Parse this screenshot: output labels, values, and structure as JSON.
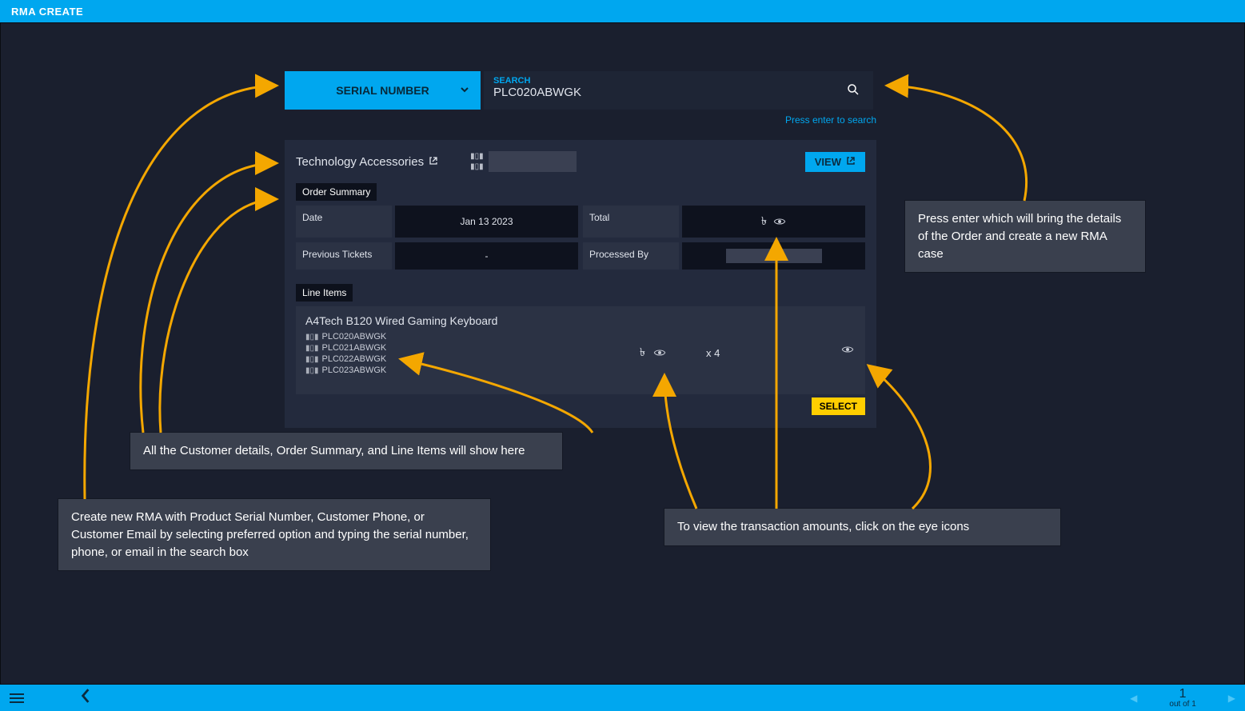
{
  "topbar": {
    "title": "RMA CREATE"
  },
  "search": {
    "dropdown_label": "SERIAL NUMBER",
    "field_label": "SEARCH",
    "value": "PLC020ABWGK",
    "hint": "Press enter to search"
  },
  "panel": {
    "company": "Technology Accessories",
    "view_label": "VIEW",
    "order_summary_label": "Order Summary",
    "summary": {
      "date_label": "Date",
      "date_value": "Jan 13 2023",
      "total_label": "Total",
      "currency_symbol": "৳",
      "prev_tickets_label": "Previous Tickets",
      "prev_tickets_value": "-",
      "processed_by_label": "Processed By"
    },
    "line_items_label": "Line Items",
    "lineitem": {
      "name": "A4Tech B120 Wired Gaming Keyboard",
      "serials": [
        "PLC020ABWGK",
        "PLC021ABWGK",
        "PLC022ABWGK",
        "PLC023ABWGK"
      ],
      "currency_symbol": "৳",
      "qty": "x 4",
      "select_label": "SELECT"
    }
  },
  "callouts": {
    "c1": "Create new RMA with Product Serial Number, Customer Phone, or Customer Email by selecting preferred option and typing the serial number, phone, or email in the search box",
    "c2": "All the Customer details, Order Summary, and Line Items will show here",
    "c3": "To view the transaction amounts, click on the eye icons",
    "c4": "Press enter which will bring the details of the Order and create a new RMA case"
  },
  "bottombar": {
    "page": "1",
    "outof": "out of 1"
  }
}
